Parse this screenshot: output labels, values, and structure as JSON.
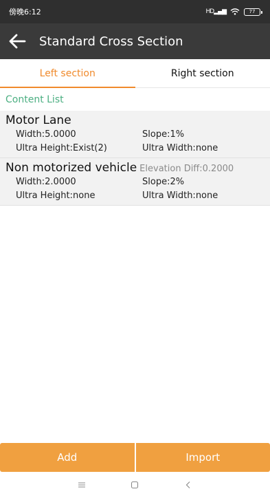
{
  "status_bar": {
    "time": "傍晚6:12",
    "signal": "HD",
    "battery": "77"
  },
  "toolbar": {
    "title": "Standard Cross Section"
  },
  "tabs": [
    {
      "label": "Left section",
      "active": true
    },
    {
      "label": "Right section",
      "active": false
    }
  ],
  "content": {
    "header": "Content List",
    "lanes": [
      {
        "name": "Motor Lane",
        "extra": "",
        "width": "Width:5.0000",
        "slope": "Slope:1%",
        "ultra_height": "Ultra Height:Exist(2)",
        "ultra_width": "Ultra Width:none"
      },
      {
        "name": "Non motorized vehicle",
        "extra": "Elevation Diff:0.2000",
        "width": "Width:2.0000",
        "slope": "Slope:2%",
        "ultra_height": "Ultra Height:none",
        "ultra_width": "Ultra Width:none"
      }
    ]
  },
  "buttons": {
    "add": "Add",
    "import": "Import"
  },
  "colors": {
    "accent": "#f08a2c",
    "button": "#f0a040",
    "header_green": "#4caf82",
    "toolbar": "#3a3a3a"
  }
}
